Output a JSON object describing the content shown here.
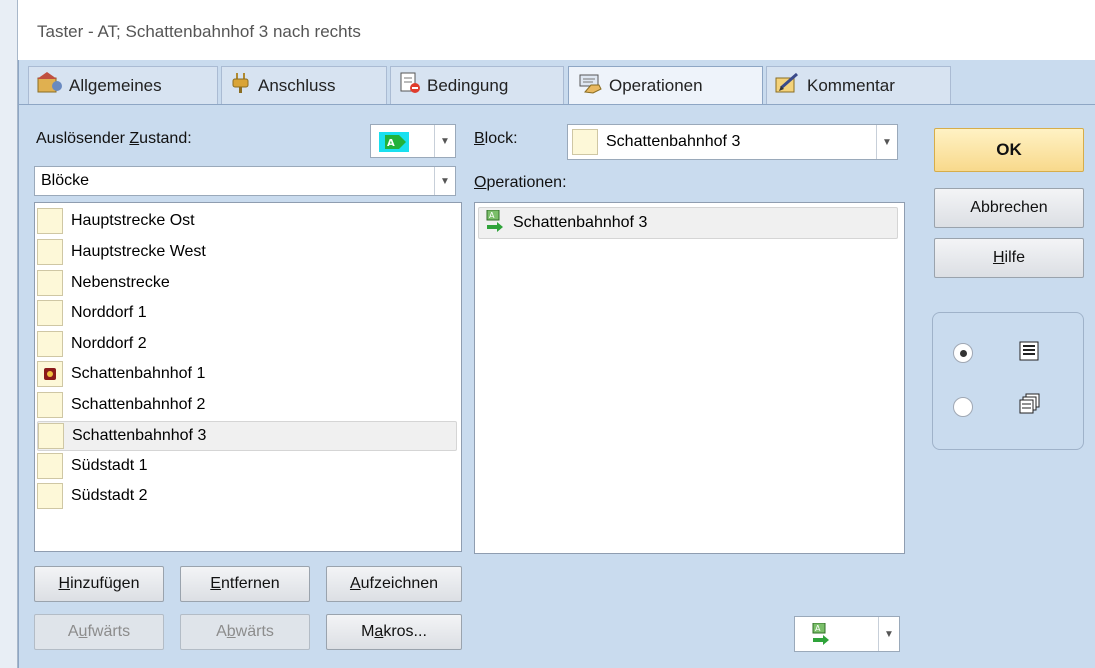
{
  "window": {
    "title": "Taster - AT; Schattenbahnhof 3 nach rechts"
  },
  "tabs": [
    {
      "label": "Allgemeines",
      "icon": "settings-icon",
      "active": false
    },
    {
      "label": "Anschluss",
      "icon": "plug-icon",
      "active": false
    },
    {
      "label": "Bedingung",
      "icon": "condition-icon",
      "active": false
    },
    {
      "label": "Operationen",
      "icon": "operations-icon",
      "active": true
    },
    {
      "label": "Kommentar",
      "icon": "comment-icon",
      "active": false
    }
  ],
  "left": {
    "trigger_label_pre": "Auslösender ",
    "trigger_label_ul": "Z",
    "trigger_label_post": "ustand:",
    "category_value": "Blöcke",
    "items": [
      "Hauptstrecke Ost",
      "Hauptstrecke West",
      "Nebenstrecke",
      "Norddorf 1",
      "Norddorf 2",
      "Schattenbahnhof 1",
      "Schattenbahnhof 2",
      "Schattenbahnhof 3",
      "Südstadt 1",
      "Südstadt 2"
    ],
    "selected_index": 7,
    "buttons": {
      "add": {
        "ul": "H",
        "rest": "inzufügen"
      },
      "remove": {
        "ul": "E",
        "rest": "ntfernen"
      },
      "record": {
        "ul": "A",
        "rest": "ufzeichnen"
      },
      "up": {
        "pre": "A",
        "ul": "u",
        "rest": "fwärts"
      },
      "down": {
        "pre": "A",
        "ul": "b",
        "rest": "wärts"
      },
      "macros": {
        "pre": "M",
        "ul": "a",
        "rest": "kros..."
      }
    }
  },
  "right": {
    "block_label_ul": "B",
    "block_label_rest": "lock:",
    "block_value": "Schattenbahnhof 3",
    "ops_label_ul": "O",
    "ops_label_rest": "perationen:",
    "operations": [
      "Schattenbahnhof 3"
    ]
  },
  "side": {
    "ok": "OK",
    "cancel": "Abbrechen",
    "help_ul": "H",
    "help_rest": "ilfe",
    "view_options": [
      {
        "icon": "list-view-icon",
        "checked": true
      },
      {
        "icon": "multi-window-icon",
        "checked": false
      }
    ]
  },
  "colors": {
    "accent_ok": "#f8d98c",
    "dialog_bg": "#c9dbee",
    "block_fill": "#fdf8d8"
  }
}
